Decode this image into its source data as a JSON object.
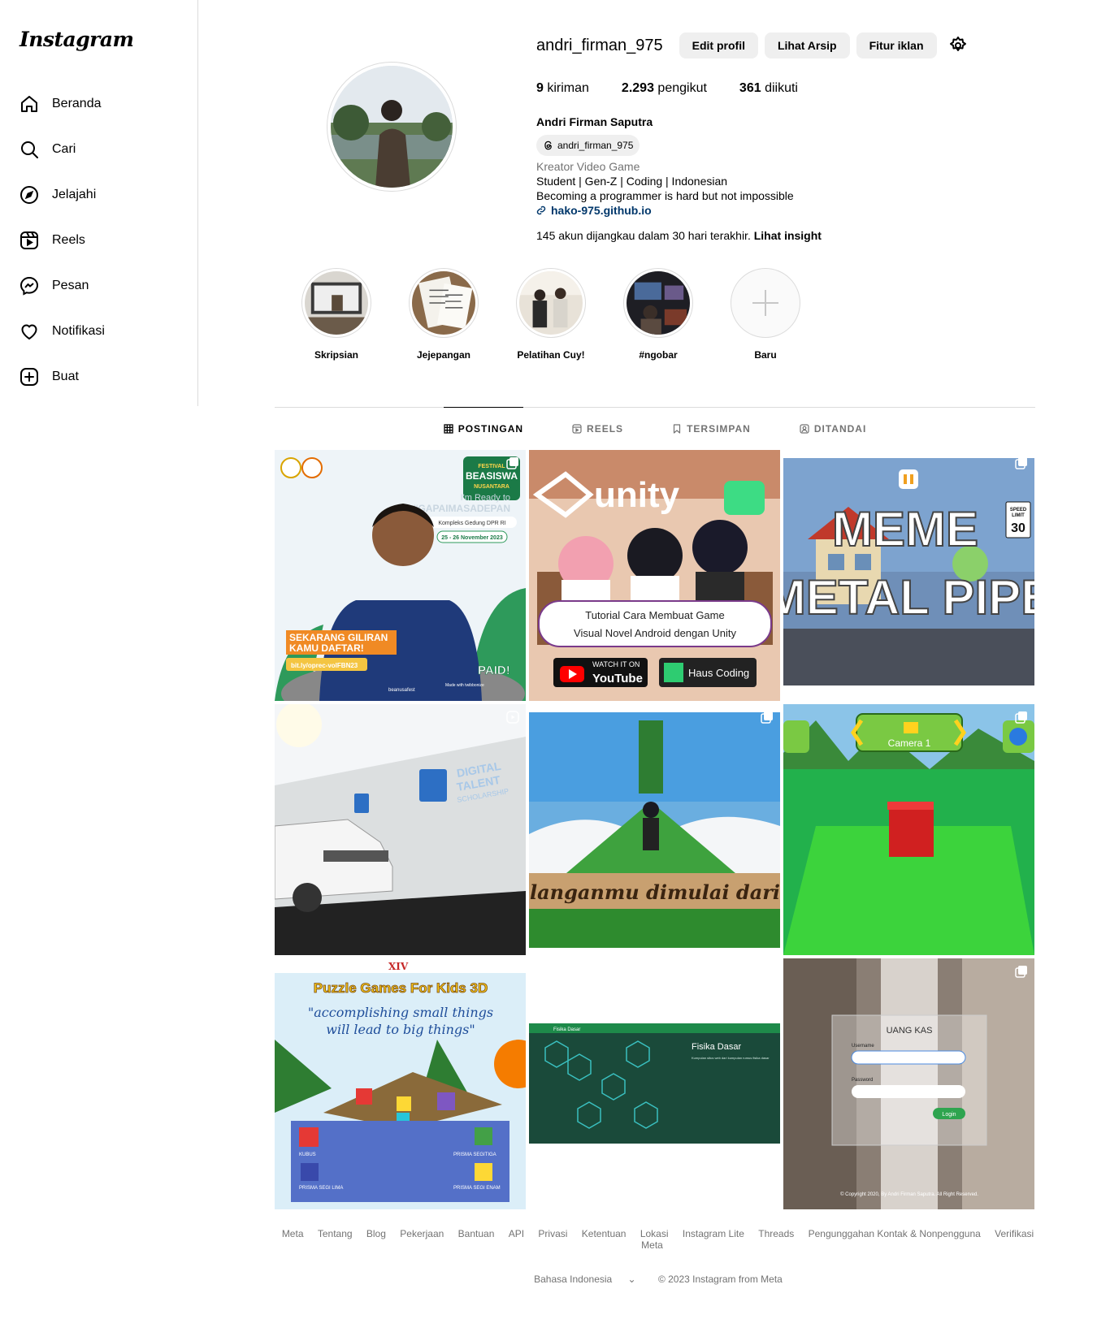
{
  "brand": {
    "logo": "Instagram"
  },
  "nav": [
    {
      "label": "Beranda",
      "icon": "home-icon"
    },
    {
      "label": "Cari",
      "icon": "search-icon"
    },
    {
      "label": "Jelajahi",
      "icon": "compass-icon"
    },
    {
      "label": "Reels",
      "icon": "reels-icon"
    },
    {
      "label": "Pesan",
      "icon": "messenger-icon"
    },
    {
      "label": "Notifikasi",
      "icon": "heart-icon"
    },
    {
      "label": "Buat",
      "icon": "plus-square-icon"
    }
  ],
  "profile": {
    "username": "andri_firman_975",
    "buttons": {
      "edit": "Edit profil",
      "archive": "Lihat Arsip",
      "ads": "Fitur iklan"
    },
    "stats": {
      "posts_count": "9",
      "posts_label": "kiriman",
      "followers_count": "2.293",
      "followers_label": "pengikut",
      "following_count": "361",
      "following_label": "diikuti"
    },
    "full_name": "Andri Firman Saputra",
    "threads_handle": "andri_firman_975",
    "category": "Kreator Video Game",
    "bio_lines": [
      "Student | Gen-Z | Coding | Indonesian",
      "Becoming a programmer is hard but not impossible"
    ],
    "link": "hako-975.github.io",
    "insight_text": "145 akun dijangkau dalam 30 hari terakhir.",
    "insight_link": "Lihat insight"
  },
  "highlights": [
    {
      "label": "Skripsian"
    },
    {
      "label": "Jejepangan"
    },
    {
      "label": "Pelatihan Cuy!"
    },
    {
      "label": "#ngobar"
    },
    {
      "label": "Baru"
    }
  ],
  "tabs": [
    {
      "label": "POSTINGAN",
      "active": true
    },
    {
      "label": "REELS"
    },
    {
      "label": "TERSIMPAN"
    },
    {
      "label": "DITANDAI"
    }
  ],
  "posts": [
    {
      "texts": [
        "I'm Ready to",
        "#GAPAIMASADEPAN",
        "Kompleks Gedung DPR RI",
        "25 - 26 November 2023",
        "SEKARANG GILIRAN",
        "KAMU DAFTAR!",
        "bit.ly/oprec-volFBN23",
        "PAID!",
        "FESTIVAL",
        "BEASISWA",
        "NUSANTARA",
        "beanusafest",
        "Made with twibbonize"
      ]
    },
    {
      "texts": [
        "unity",
        "Tutorial Cara Membuat Game",
        "Visual Novel Android dengan Unity",
        "WATCH IT ON",
        "YouTube",
        "Haus Coding"
      ]
    },
    {
      "texts": [
        "MEME",
        "METAL PIPE",
        "SPEED",
        "LIMIT",
        "30"
      ]
    },
    {
      "texts": [
        "DIGITAL",
        "TALENT",
        "SCHOLARSHIP"
      ]
    },
    {
      "texts": [
        "langanmu dimulai dari"
      ]
    },
    {
      "texts": [
        "Camera 1"
      ]
    },
    {
      "texts": [
        "XIV",
        "Puzzle Games For Kids 3D",
        "\"accomplishing small things",
        "will lead to big things\"",
        "KUBUS",
        "PRISMA SEGITIGA",
        "PRISMA SEGI LIMA",
        "PRISMA SEGI ENAM"
      ]
    },
    {
      "texts": [
        "Fisika Dasar",
        "Fisika Dasar",
        "Kumpulan situs web dari kumpulan rumus fisika dasar"
      ]
    },
    {
      "texts": [
        "UANG KAS",
        "Username",
        "Password",
        "Login",
        "© Copyright 2020, By Andri Firman Saputra. All Right Reserved."
      ]
    }
  ],
  "footer": {
    "links": [
      "Meta",
      "Tentang",
      "Blog",
      "Pekerjaan",
      "Bantuan",
      "API",
      "Privasi",
      "Ketentuan",
      "Lokasi",
      "Instagram Lite",
      "Threads",
      "Pengunggahan Kontak & Nonpengguna",
      "Verifikasi Meta"
    ],
    "language": "Bahasa Indonesia",
    "copyright": "© 2023 Instagram from Meta"
  }
}
